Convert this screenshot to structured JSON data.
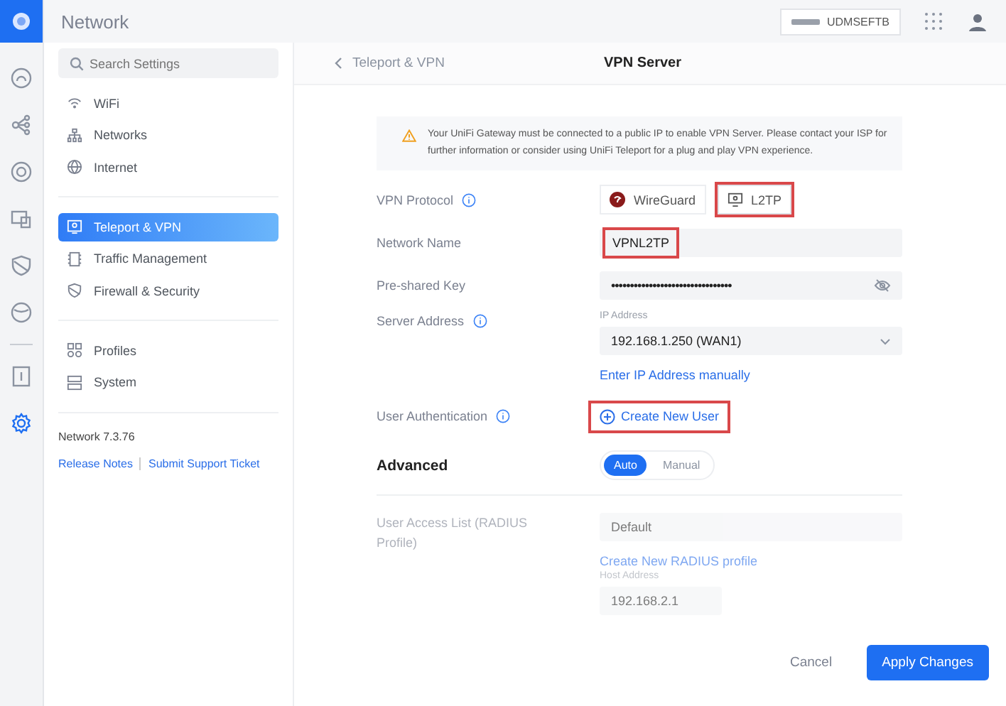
{
  "app": {
    "title": "Network",
    "device": "UDMSEFTB"
  },
  "rail": [
    {
      "kind": "dashboard",
      "selected": false
    },
    {
      "kind": "topology",
      "selected": false
    },
    {
      "kind": "target",
      "selected": false
    },
    {
      "kind": "devices",
      "selected": false
    },
    {
      "kind": "shield",
      "selected": false
    },
    {
      "kind": "globe",
      "selected": false
    },
    {
      "kind": "list",
      "selected": false
    },
    {
      "kind": "settings",
      "selected": true
    }
  ],
  "search": {
    "placeholder": "Search Settings"
  },
  "nav_groups": [
    [
      {
        "label": "WiFi",
        "kind": "wifi",
        "selected": false
      },
      {
        "label": "Networks",
        "kind": "networks",
        "selected": false
      },
      {
        "label": "Internet",
        "kind": "internet",
        "selected": false
      }
    ],
    [
      {
        "label": "Teleport & VPN",
        "kind": "vpn",
        "selected": true
      },
      {
        "label": "Traffic Management",
        "kind": "traffic",
        "selected": false
      },
      {
        "label": "Firewall & Security",
        "kind": "firewall",
        "selected": false
      }
    ],
    [
      {
        "label": "Profiles",
        "kind": "profiles",
        "selected": false
      },
      {
        "label": "System",
        "kind": "system",
        "selected": false
      }
    ]
  ],
  "version": "Network 7.3.76",
  "footer_links": [
    "Release Notes",
    "Submit Support Ticket"
  ],
  "breadcrumb": {
    "back": "Teleport & VPN",
    "title": "VPN Server"
  },
  "warning": "Your UniFi Gateway must be connected to a public IP to enable VPN Server. Please contact your ISP for further information or consider using UniFi Teleport for a plug and play VPN experience.",
  "vpn_protocol": {
    "label": "VPN Protocol",
    "options": [
      {
        "label": "WireGuard",
        "kind": "wireguard",
        "selected": false,
        "highlighted": false
      },
      {
        "label": "L2TP",
        "kind": "l2tp",
        "selected": true,
        "highlighted": true
      }
    ]
  },
  "network_name": {
    "label": "Network Name",
    "value": "VPNL2TP",
    "highlighted": true
  },
  "preshared_key": {
    "label": "Pre-shared Key",
    "value": "••••••••••••••••••••••••••••••••"
  },
  "server_address": {
    "label": "Server Address",
    "field_label": "IP Address",
    "value": "192.168.1.250 (WAN1)",
    "link": "Enter IP Address manually"
  },
  "user_authentication": {
    "label": "User Authentication",
    "link": "Create New User",
    "highlighted": true
  },
  "advanced": {
    "label": "Advanced",
    "options": [
      {
        "label": "Auto",
        "selected": true
      },
      {
        "label": "Manual",
        "selected": false
      }
    ]
  },
  "faded": {
    "radius_label": "User Access List (RADIUS Profile)",
    "radius_value": "Default",
    "radius_link": "Create New RADIUS profile",
    "host_label": "Host Address",
    "host_value": "192.168.2.1"
  },
  "actions": {
    "cancel": "Cancel",
    "apply": "Apply Changes"
  }
}
